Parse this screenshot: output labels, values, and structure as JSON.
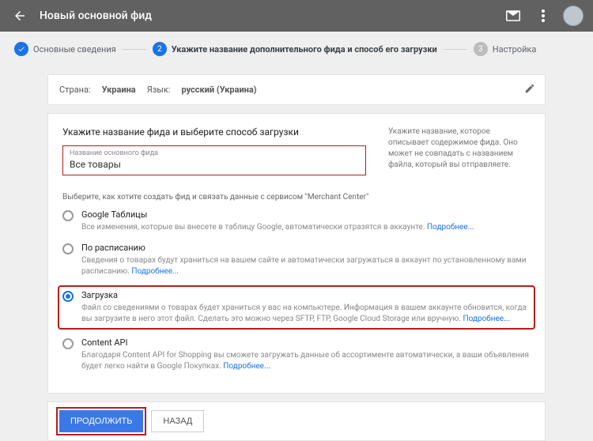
{
  "header": {
    "title": "Новый основной фид"
  },
  "stepper": {
    "step1": {
      "label": "Основные сведения"
    },
    "step2": {
      "num": "2",
      "label": "Укажите название дополнительного фида и способ его загрузки"
    },
    "step3": {
      "num": "3",
      "label": "Настройка"
    }
  },
  "meta_card": {
    "country_label": "Страна:",
    "country_value": "Украина",
    "language_label": "Язык:",
    "language_value": "русский (Украина)"
  },
  "main": {
    "section_title": "Укажите название фида и выберите способ загрузки",
    "field_label": "Название основного фида",
    "field_value": "Все товары",
    "help_text": "Укажите название, которое описывает содержимое фида. Оно может не совпадать с названием файла, который вы отправляете.",
    "sub_instruction": "Выберите, как хотите создать фид и связать данные с сервисом \"Merchant Center\"",
    "more": "Подробнее...",
    "options": {
      "sheets": {
        "title": "Google Таблицы",
        "desc": "Все изменения, которые вы внесете в таблицу Google, автоматически отразятся в аккаунте."
      },
      "schedule": {
        "title": "По расписанию",
        "desc": "Сведения о товарах будут храниться на вашем сайте и автоматически загружаться в аккаунт по установленному вами расписанию."
      },
      "upload": {
        "title": "Загрузка",
        "desc": "Файл со сведениями о товарах будет храниться у вас на компьютере. Информация в вашем аккаунте обновится, когда вы загрузите в него этот файл. Сделать это можно через SFTP, FTP, Google Cloud Storage или вручную."
      },
      "api": {
        "title": "Content API",
        "desc": "Благодаря Content API for Shopping вы сможете загружать данные об ассортименте автоматически, а ваши объявления будет легко найти в Google Покупках."
      }
    }
  },
  "footer": {
    "continue": "Продолжить",
    "back": "Назад"
  }
}
